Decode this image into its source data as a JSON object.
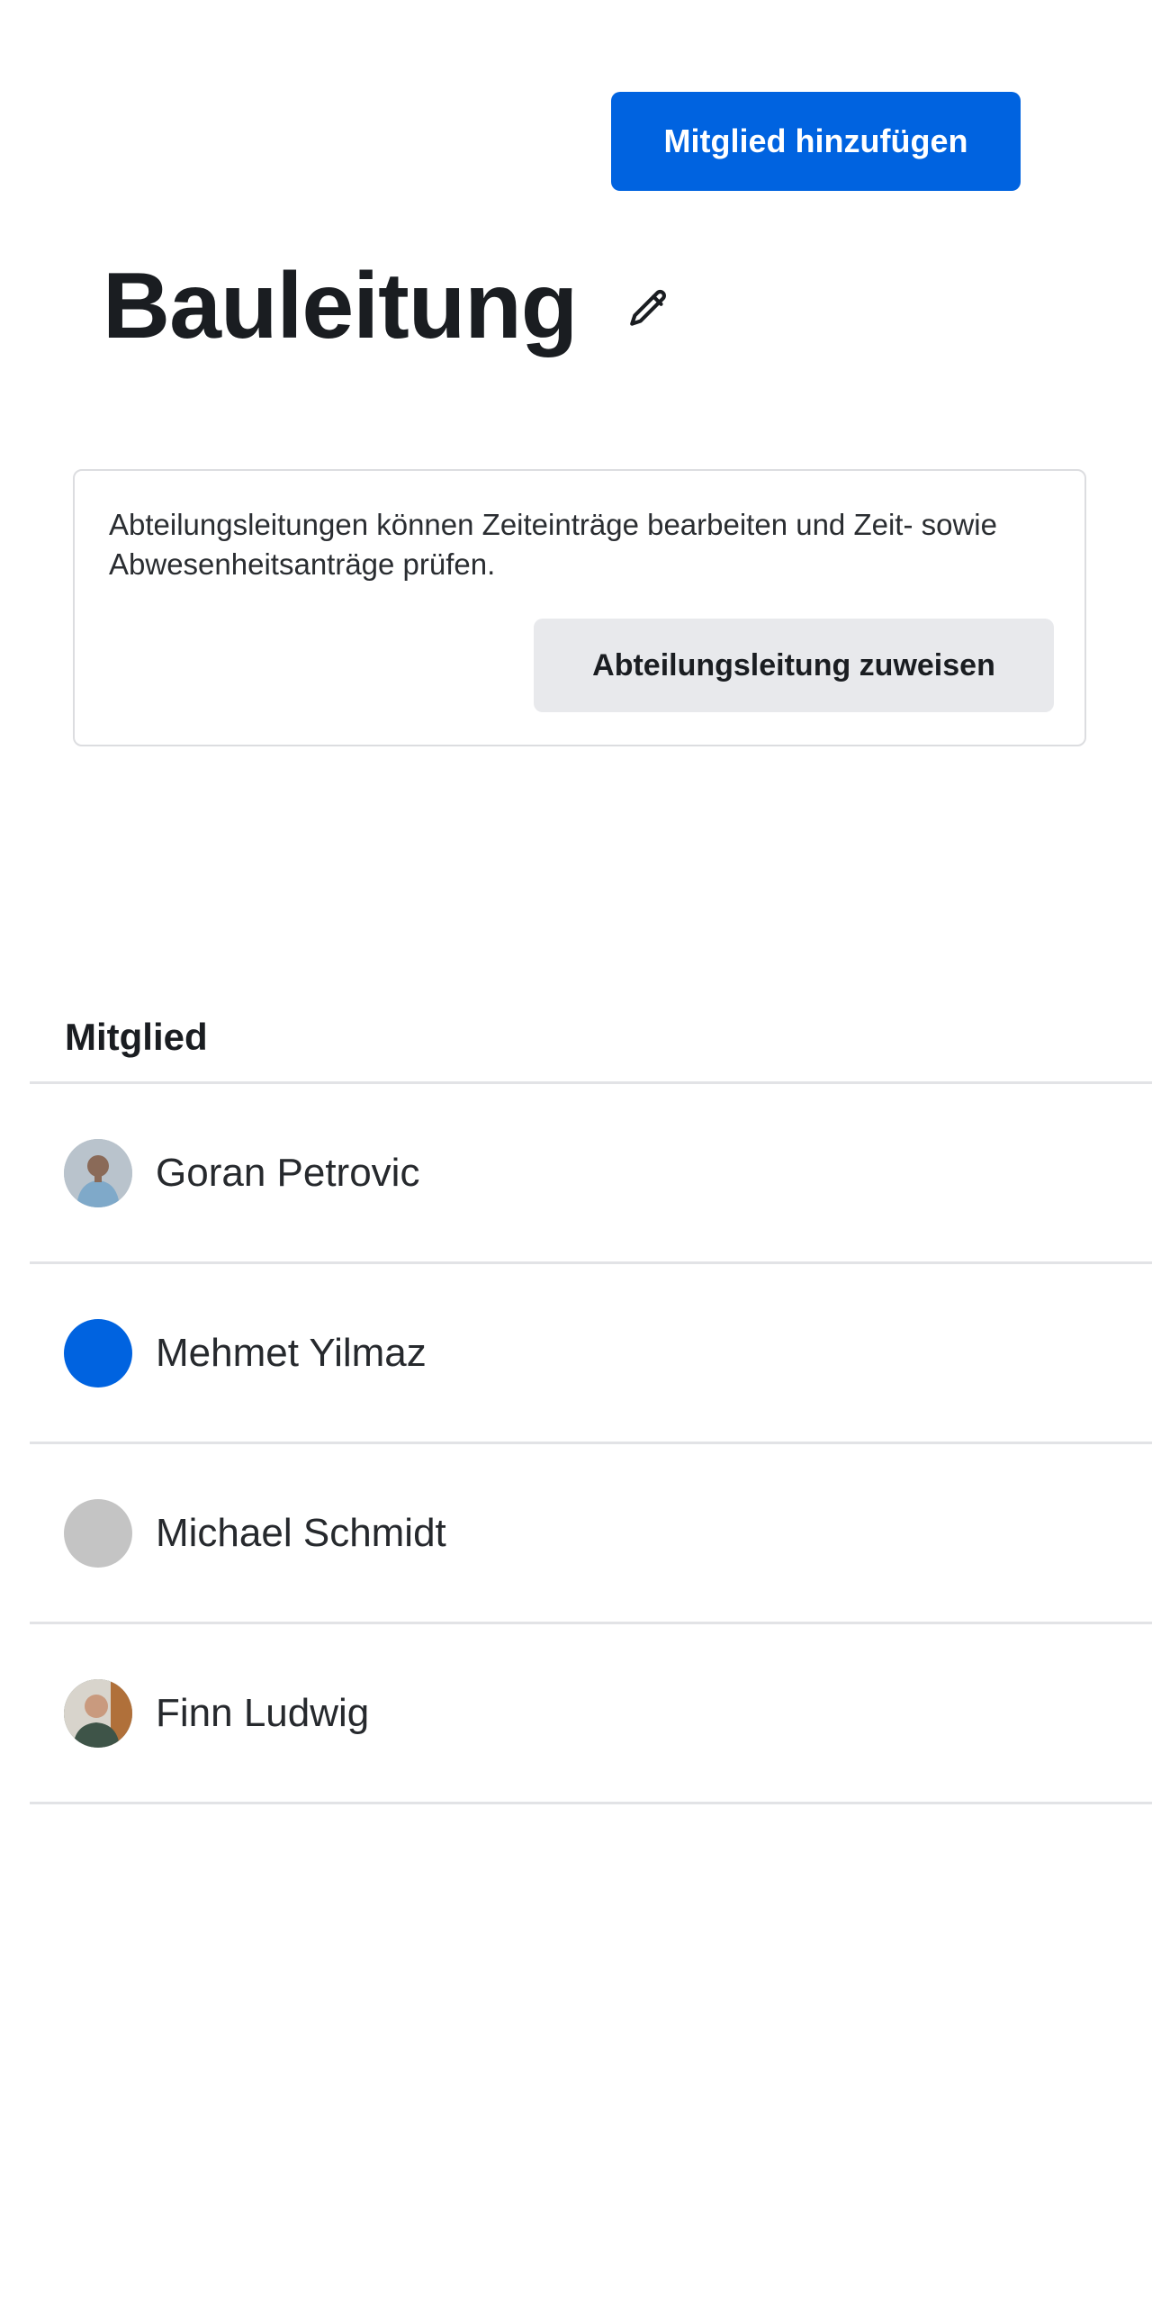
{
  "header": {
    "add_member_label": "Mitglied hinzufügen"
  },
  "department": {
    "title": "Bauleitung",
    "edit_icon": "pencil-icon"
  },
  "info_card": {
    "text": "Abteilungsleitungen können Zeiteinträge bearbeiten und Zeit- sowie Abwesenheitsanträge prüfen.",
    "assign_lead_label": "Abteilungsleitung zuweisen"
  },
  "table": {
    "column_member": "Mitglied",
    "rows": [
      {
        "name": "Goran Petrovic",
        "avatar": "photo",
        "avatar_color": "#b8c2cc"
      },
      {
        "name": "Mehmet Yilmaz",
        "avatar": "solid",
        "avatar_color": "#0063e0"
      },
      {
        "name": "Michael Schmidt",
        "avatar": "solid",
        "avatar_color": "#c4c4c4"
      },
      {
        "name": "Finn Ludwig",
        "avatar": "photo",
        "avatar_color": "#5a6b60"
      }
    ]
  },
  "colors": {
    "primary": "#0063e0",
    "secondary_button": "#e8e9ec",
    "border": "#dcdde0",
    "text": "#1a1d21"
  }
}
